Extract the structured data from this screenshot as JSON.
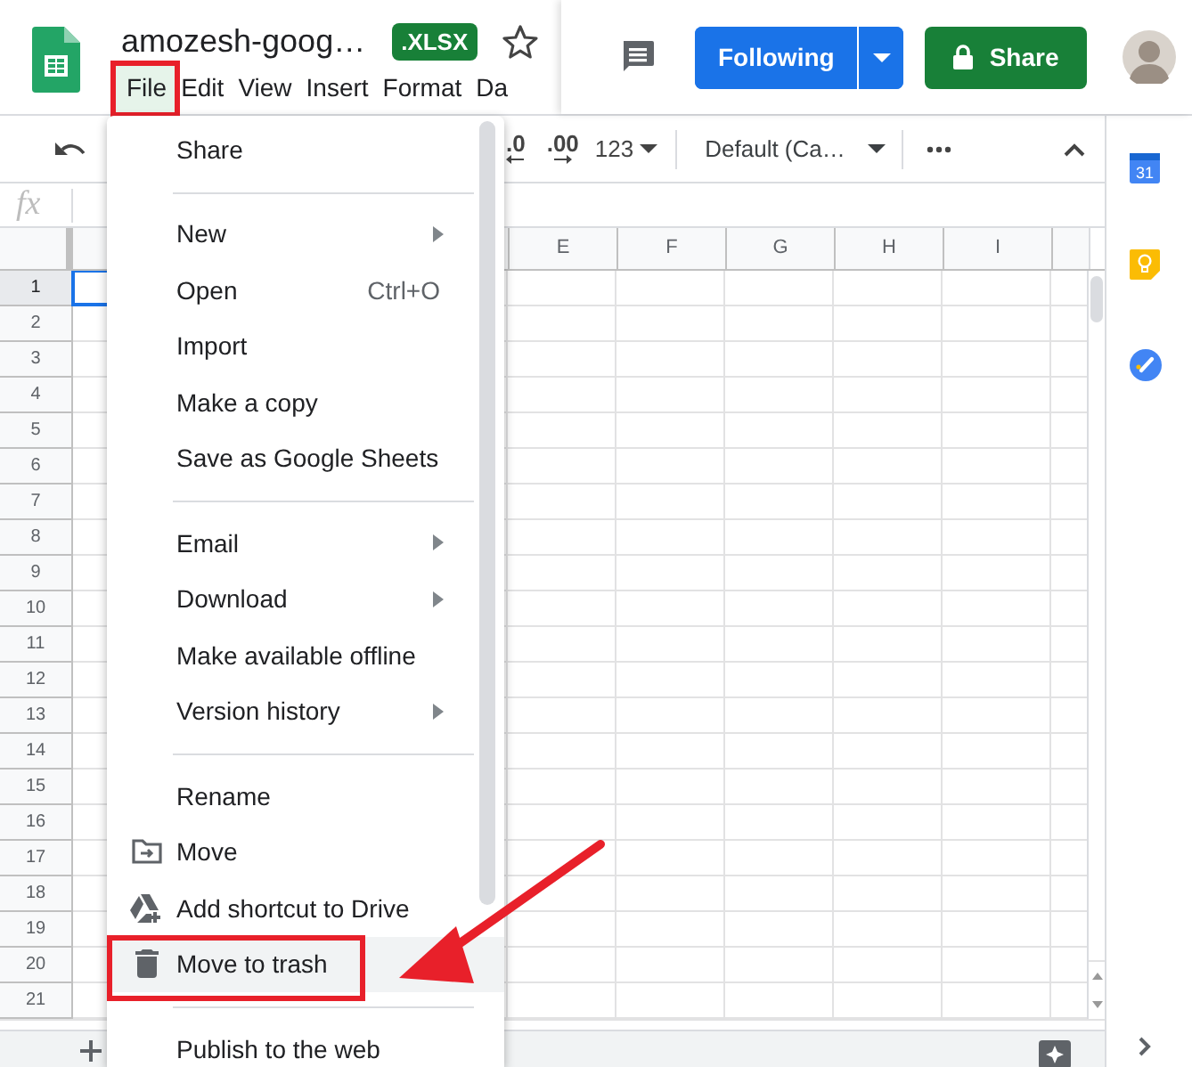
{
  "header": {
    "title": "amozesh-goog…",
    "badge": ".XLSX",
    "follow_button": {
      "label": "Following"
    },
    "share_button": {
      "label": "Share"
    }
  },
  "menu_bar": [
    {
      "label": "File",
      "selected": true,
      "callout": true
    },
    {
      "label": "Edit",
      "selected": false,
      "callout": false
    },
    {
      "label": "View",
      "selected": false,
      "callout": false
    },
    {
      "label": "Insert",
      "selected": false,
      "callout": false
    },
    {
      "label": "Format",
      "selected": false,
      "callout": false
    },
    {
      "label": "Da",
      "selected": false,
      "callout": false
    }
  ],
  "toolbar": {
    "decrease_decimals": ".0",
    "increase_decimals": ".00",
    "number_format": "123",
    "font": "Default (Ca…"
  },
  "formula_bar": {
    "label": "fx"
  },
  "grid": {
    "columns": [
      {
        "label": "E"
      },
      {
        "label": "F"
      },
      {
        "label": "G"
      },
      {
        "label": "H"
      },
      {
        "label": "I"
      }
    ],
    "rows": [
      {
        "label": "1",
        "selected": true
      },
      {
        "label": "2",
        "selected": false
      },
      {
        "label": "3",
        "selected": false
      },
      {
        "label": "4",
        "selected": false
      },
      {
        "label": "5",
        "selected": false
      },
      {
        "label": "6",
        "selected": false
      },
      {
        "label": "7",
        "selected": false
      },
      {
        "label": "8",
        "selected": false
      },
      {
        "label": "9",
        "selected": false
      },
      {
        "label": "10",
        "selected": false
      },
      {
        "label": "11",
        "selected": false
      },
      {
        "label": "12",
        "selected": false
      },
      {
        "label": "13",
        "selected": false
      },
      {
        "label": "14",
        "selected": false
      },
      {
        "label": "15",
        "selected": false
      },
      {
        "label": "16",
        "selected": false
      },
      {
        "label": "17",
        "selected": false
      },
      {
        "label": "18",
        "selected": false
      },
      {
        "label": "19",
        "selected": false
      },
      {
        "label": "20",
        "selected": false
      },
      {
        "label": "21",
        "selected": false
      }
    ]
  },
  "file_menu": {
    "items": [
      {
        "kind": "item",
        "label": "Share",
        "submenu": false,
        "selected": false,
        "callout": false
      },
      {
        "kind": "separator"
      },
      {
        "kind": "item",
        "label": "New",
        "submenu": true,
        "selected": false,
        "callout": false
      },
      {
        "kind": "item",
        "label": "Open",
        "shortcut": "Ctrl+O",
        "submenu": false,
        "selected": false,
        "callout": false
      },
      {
        "kind": "item",
        "label": "Import",
        "submenu": false,
        "selected": false,
        "callout": false
      },
      {
        "kind": "item",
        "label": "Make a copy",
        "submenu": false,
        "selected": false,
        "callout": false
      },
      {
        "kind": "item",
        "label": "Save as Google Sheets",
        "submenu": false,
        "selected": false,
        "callout": false
      },
      {
        "kind": "separator"
      },
      {
        "kind": "item",
        "label": "Email",
        "submenu": true,
        "selected": false,
        "callout": false
      },
      {
        "kind": "item",
        "label": "Download",
        "submenu": true,
        "selected": false,
        "callout": false
      },
      {
        "kind": "item",
        "label": "Make available offline",
        "submenu": false,
        "selected": false,
        "callout": false
      },
      {
        "kind": "item",
        "label": "Version history",
        "submenu": true,
        "selected": false,
        "callout": false
      },
      {
        "kind": "separator"
      },
      {
        "kind": "item",
        "label": "Rename",
        "submenu": false,
        "selected": false,
        "callout": false
      },
      {
        "kind": "move_item",
        "label": "Move",
        "submenu": false,
        "selected": false,
        "callout": false
      },
      {
        "kind": "shortcut_item",
        "label": "Add shortcut to Drive",
        "submenu": false,
        "selected": false,
        "callout": false
      },
      {
        "kind": "trash_item",
        "label": "Move to trash",
        "submenu": false,
        "selected": true,
        "callout": true
      },
      {
        "kind": "separator"
      },
      {
        "kind": "item",
        "label": "Publish to the web",
        "submenu": false,
        "selected": false,
        "callout": false
      }
    ]
  },
  "side_panel": {
    "calendar_label": "31"
  },
  "annotation_arrow": true
}
